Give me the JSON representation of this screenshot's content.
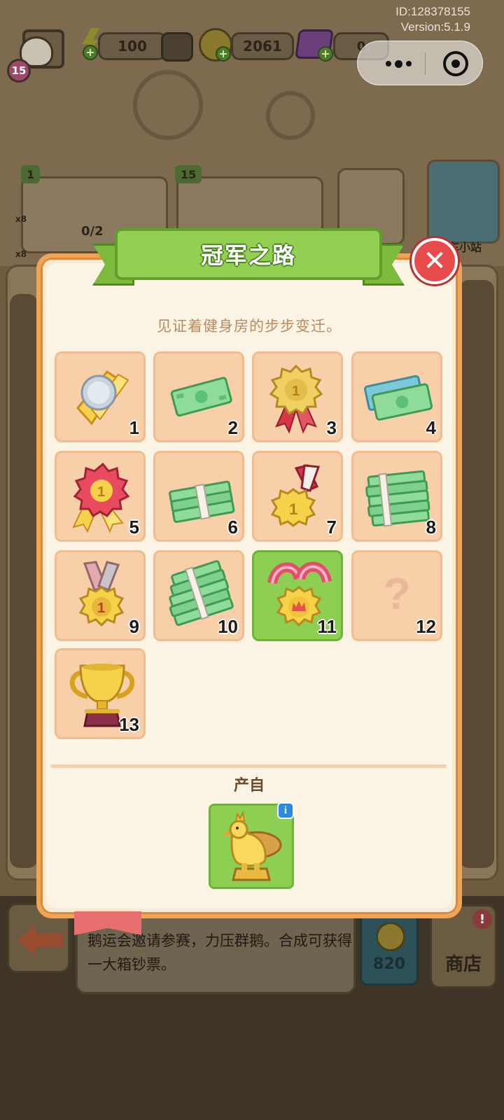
{
  "hud": {
    "account_id": "ID:128378155",
    "version": "Version:5.1.9",
    "player_level": "15",
    "energy": "100",
    "coins": "2061",
    "gems": "0"
  },
  "background": {
    "card1_tag": "1",
    "card1_progress": "0/2",
    "card2_tag": "15",
    "side_counts": [
      "x8",
      "x8"
    ],
    "station_label": "车小站",
    "bottom_description": "鹅运会邀请参赛，力压群鹅。合成可获得一大箱钞票。",
    "price": "820",
    "shop_label": "商店",
    "shop_badge": "!"
  },
  "modal": {
    "title": "冠军之路",
    "subtitle": "见证着健身房的步步变迁。",
    "close_icon": "✕",
    "items": [
      {
        "num": "1",
        "icon": "silver-ribbon-medal-icon",
        "state": "unlocked"
      },
      {
        "num": "2",
        "icon": "banknote-icon",
        "state": "unlocked"
      },
      {
        "num": "3",
        "icon": "gold-rosette-ribbon-icon",
        "state": "unlocked"
      },
      {
        "num": "4",
        "icon": "banknote-stack-icon",
        "state": "unlocked"
      },
      {
        "num": "5",
        "icon": "red-rosette-ribbon-icon",
        "state": "unlocked"
      },
      {
        "num": "6",
        "icon": "money-bundle-icon",
        "state": "unlocked"
      },
      {
        "num": "7",
        "icon": "gold-medal-icon",
        "state": "unlocked"
      },
      {
        "num": "8",
        "icon": "money-bundles-icon",
        "state": "unlocked"
      },
      {
        "num": "9",
        "icon": "champion-medal-icon",
        "state": "unlocked"
      },
      {
        "num": "10",
        "icon": "money-pile-icon",
        "state": "unlocked"
      },
      {
        "num": "11",
        "icon": "crown-medal-icon",
        "state": "current"
      },
      {
        "num": "12",
        "icon": "question-mark-icon",
        "state": "locked",
        "glyph": "?"
      },
      {
        "num": "13",
        "icon": "trophy-icon",
        "state": "unlocked"
      }
    ],
    "source_label": "产自",
    "source_icon": "golden-goose-statue-icon",
    "info_glyph": "i"
  },
  "colors": {
    "modal_border": "#f0a455",
    "banner_green": "#92cf52",
    "cell_bg": "#f7cfa8",
    "cell_active": "#8ccf53",
    "close_red": "#e84b4b"
  }
}
